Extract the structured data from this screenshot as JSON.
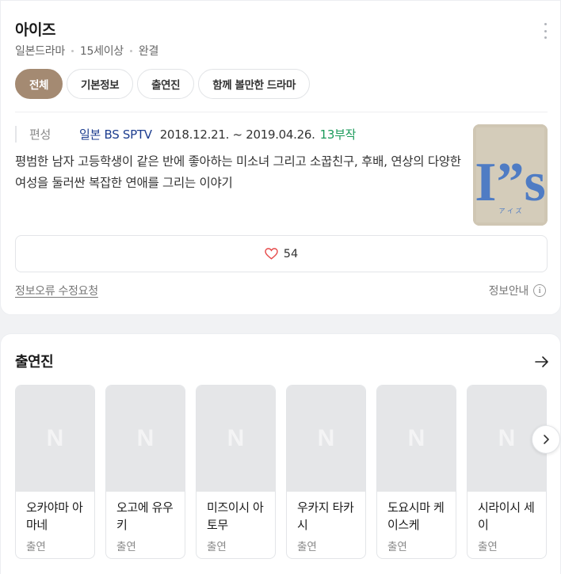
{
  "header": {
    "title": "아이즈",
    "meta": [
      "일본드라마",
      "15세이상",
      "완결"
    ]
  },
  "tabs": [
    "전체",
    "기본정보",
    "출연진",
    "함께 볼만한 드라마"
  ],
  "info": {
    "label": "편성",
    "broadcast": "일본 BS SPTV",
    "date": "2018.12.21. ~ 2019.04.26.",
    "episodes": "13부작",
    "synopsis": "평범한 남자 고등학생이 같은 반에 좋아하는 미소녀 그리고 소꿉친구, 후배, 연상의 다양한 여성을 둘러싼 복잡한 연애를 그리는 이야기"
  },
  "poster": {
    "logo": "I”s",
    "subtitle": "ア イ ズ"
  },
  "like": {
    "count": "54"
  },
  "footer": {
    "error_link": "정보오류 수정요청",
    "info_guide": "정보안내"
  },
  "cast_section": {
    "title": "출연진",
    "placeholder": "N",
    "members": [
      {
        "name": "오카야마 아마네",
        "role": "출연"
      },
      {
        "name": "오고에 유우키",
        "role": "출연"
      },
      {
        "name": "미즈이시 아토무",
        "role": "출연"
      },
      {
        "name": "우카지 타카시",
        "role": "출연"
      },
      {
        "name": "도요시마 케이스케",
        "role": "출연"
      },
      {
        "name": "시라이시 세이",
        "role": "출연"
      }
    ]
  },
  "colors": {
    "accent": "#a48a72",
    "broadcast": "#1d3d8f",
    "episodes": "#1a9a5a",
    "heart": "#e64a4a"
  }
}
